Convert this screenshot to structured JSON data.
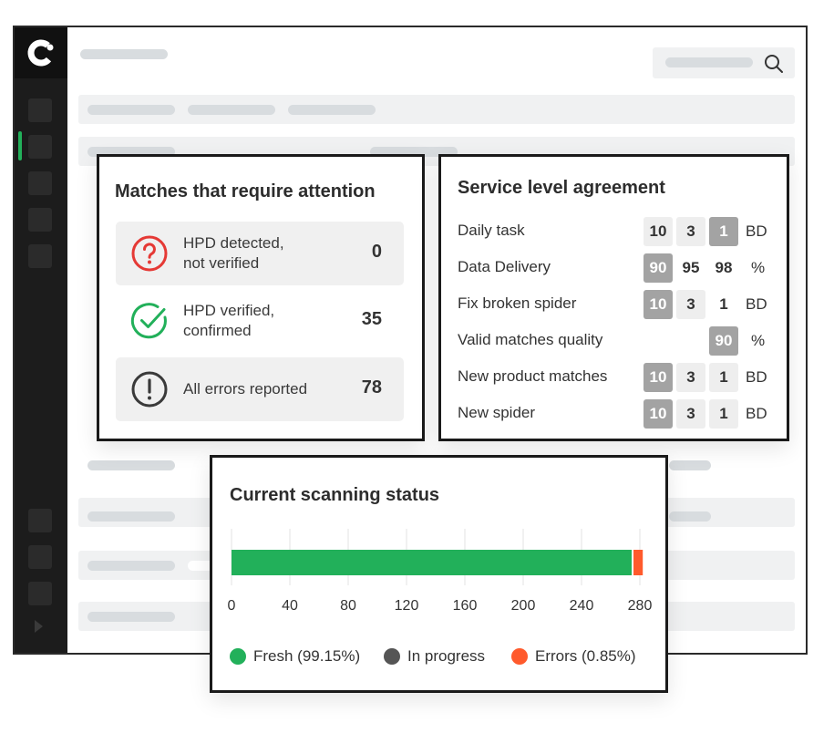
{
  "matches_card": {
    "title": "Matches that require attention",
    "rows": [
      {
        "label_line1": "HPD detected,",
        "label_line2": "not verified",
        "value": "0",
        "icon": "question-circle-icon",
        "icon_color": "#e53935"
      },
      {
        "label_line1": "HPD verified,",
        "label_line2": "confirmed",
        "value": "35",
        "icon": "check-circle-icon",
        "icon_color": "#22b05a"
      },
      {
        "label_line1": "All errors reported",
        "value": "78",
        "icon": "exclamation-circle-icon",
        "icon_color": "#3a3a3a"
      }
    ]
  },
  "sla_card": {
    "title": "Service level agreement",
    "rows": [
      {
        "label": "Daily task",
        "values": [
          "10",
          "3",
          "1"
        ],
        "unit": "BD"
      },
      {
        "label": "Data Delivery",
        "values": [
          "90",
          "95",
          "98"
        ],
        "unit": "%"
      },
      {
        "label": "Fix broken spider",
        "values": [
          "10",
          "3",
          "1"
        ],
        "unit": "BD"
      },
      {
        "label": "Valid matches quality",
        "values": [
          "90"
        ],
        "unit": "%"
      },
      {
        "label": "New product matches",
        "values": [
          "10",
          "3",
          "1"
        ],
        "unit": "BD"
      },
      {
        "label": "New spider",
        "values": [
          "10",
          "3",
          "1"
        ],
        "unit": "BD"
      }
    ]
  },
  "scan_card": {
    "title": "Current scanning status",
    "legend": {
      "fresh": "Fresh (99.15%)",
      "in_progress": "In progress",
      "errors": "Errors (0.85%)"
    }
  },
  "chart_data": {
    "type": "bar",
    "orientation": "horizontal",
    "stacked": true,
    "title": "Current scanning status",
    "xlim": [
      0,
      280
    ],
    "ticks": [
      "0",
      "40",
      "80",
      "120",
      "160",
      "200",
      "240",
      "280"
    ],
    "series": [
      {
        "name": "Fresh (99.15%)",
        "value": 275,
        "color": "#22b05a"
      },
      {
        "name": "In progress",
        "value": 0,
        "color": "#555555"
      },
      {
        "name": "Errors (0.85%)",
        "value": 7,
        "color": "#ff5a2c"
      }
    ],
    "grid": true,
    "legend_position": "bottom"
  },
  "colors": {
    "accent": "#22b05a",
    "error": "#ff5a2c",
    "alert": "#e53935"
  }
}
